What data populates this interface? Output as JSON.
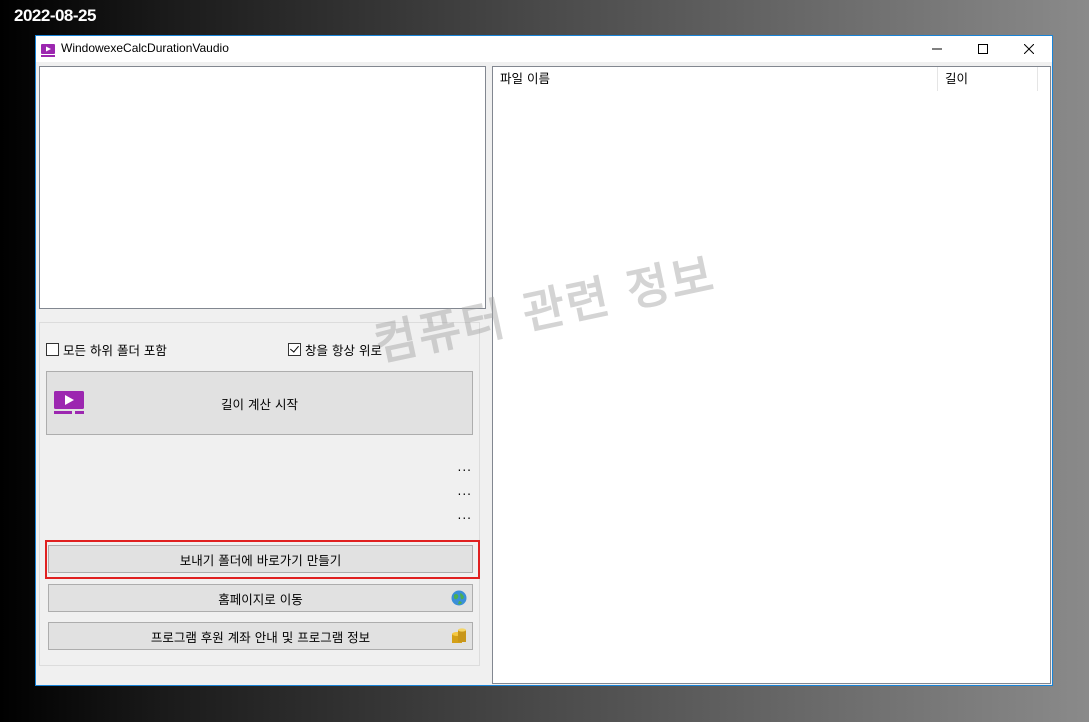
{
  "date_stamp": "2022-08-25",
  "window": {
    "title": "WindowexeCalcDurationVaudio",
    "accent_color": "#1883d7"
  },
  "options": {
    "include_subfolders_label": "모든 하위 폴더 포함",
    "include_subfolders_checked": false,
    "always_on_top_label": "창을 항상 위로",
    "always_on_top_checked": true
  },
  "start_button": {
    "label": "길이 계산 시작",
    "icon": "video-play-icon"
  },
  "status_lines": [
    "...",
    "...",
    "..."
  ],
  "buttons": {
    "send_to_shortcut": "보내기 폴더에 바로가기 만들기",
    "homepage": "홈페이지로 이동",
    "donate_info": "프로그램 후원 계좌 안내 및 프로그램 정보"
  },
  "file_list": {
    "columns": [
      "파일 이름",
      "길이"
    ],
    "rows": []
  },
  "watermark": "컴퓨터 관련 정보",
  "colors": {
    "highlight_border": "#e02020",
    "icon_purple": "#9c27b0"
  }
}
